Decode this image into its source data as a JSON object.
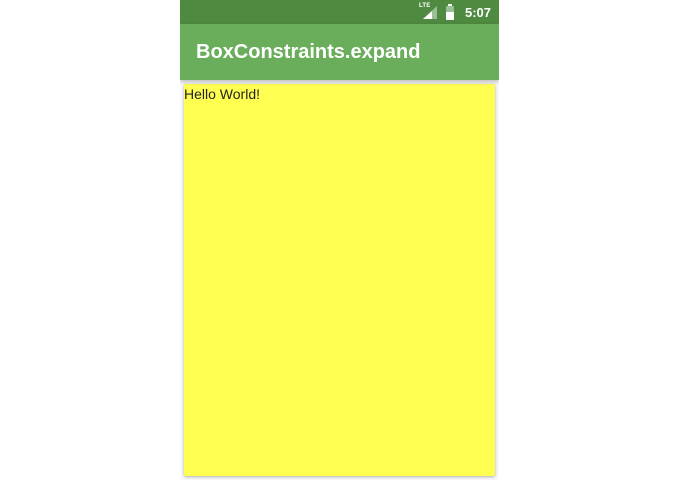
{
  "status_bar": {
    "network_label": "LTE",
    "time": "5:07",
    "icons": [
      "lte-signal-icon",
      "battery-icon"
    ],
    "background_color": "#4e8a3f"
  },
  "app_bar": {
    "title": "BoxConstraints.expand",
    "background_color": "#6aae5b"
  },
  "content": {
    "text": "Hello World!",
    "box_color": "#ffff52"
  }
}
